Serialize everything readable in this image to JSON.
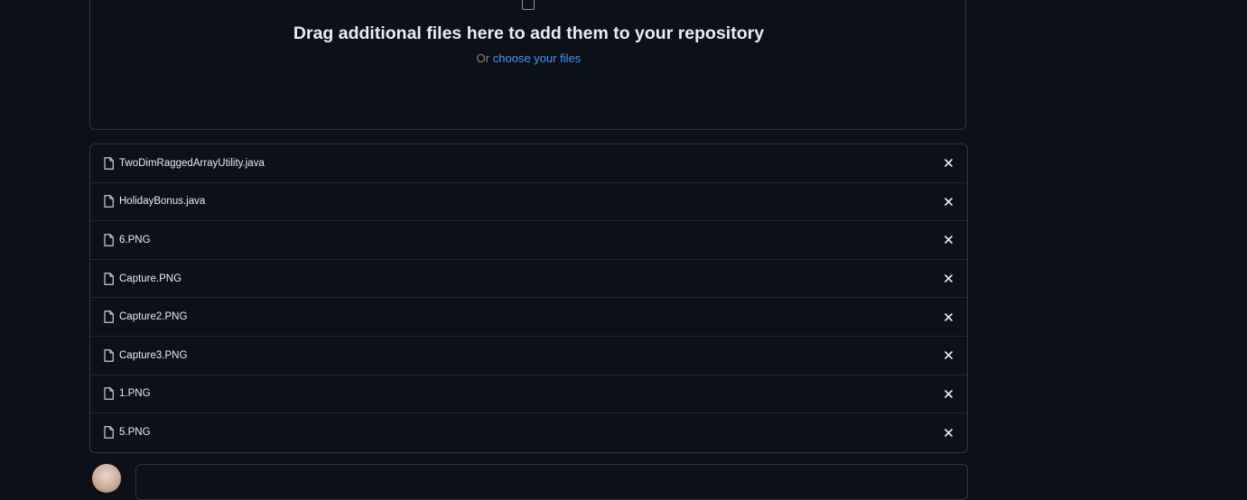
{
  "dropzone": {
    "title": "Drag additional files here to add them to your repository",
    "sub_prefix": "Or",
    "choose_link": "choose your files"
  },
  "files": [
    {
      "name": "TwoDimRaggedArrayUtility.java"
    },
    {
      "name": "HolidayBonus.java"
    },
    {
      "name": "6.PNG"
    },
    {
      "name": "Capture.PNG"
    },
    {
      "name": "Capture2.PNG"
    },
    {
      "name": "Capture3.PNG"
    },
    {
      "name": "1.PNG"
    },
    {
      "name": "5.PNG"
    }
  ],
  "colors": {
    "background": "#0d1117",
    "border": "#30363d",
    "link": "#4493f8",
    "muted": "#7d8590",
    "text": "#e6edf3"
  },
  "icons": {
    "file": "file-icon",
    "remove": "x-icon",
    "drop": "file-outline-icon"
  }
}
